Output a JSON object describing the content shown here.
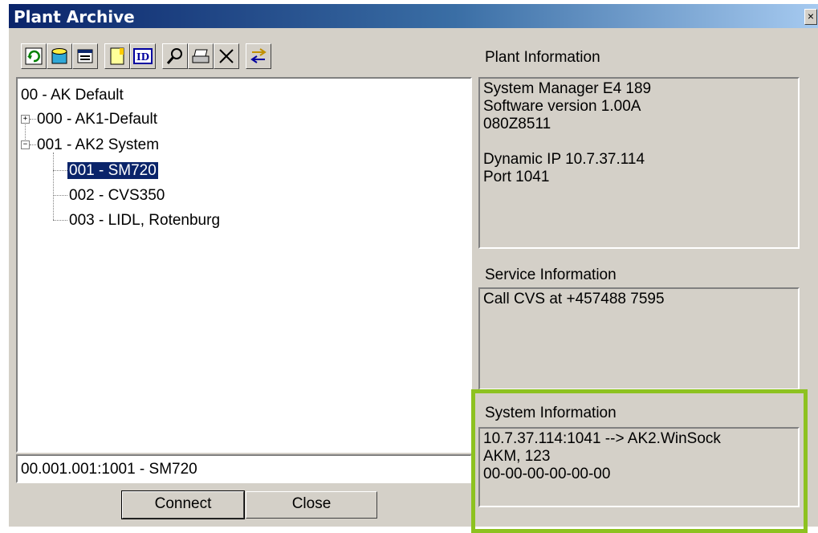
{
  "window": {
    "title": "Plant Archive",
    "close_glyph": "×"
  },
  "toolbar": {
    "icons": [
      "refresh-icon",
      "database-icon",
      "properties-icon",
      "new-document-icon",
      "id-icon",
      "find-icon",
      "print-icon",
      "delete-icon",
      "transfer-icon"
    ]
  },
  "tree": {
    "items": [
      {
        "label": "00 - AK Default",
        "level": 0
      },
      {
        "label": "000 - AK1-Default",
        "level": 1,
        "expander": "+"
      },
      {
        "label": "001 - AK2 System",
        "level": 1,
        "expander": "−"
      },
      {
        "label": "001 - SM720",
        "level": 2,
        "selected": true
      },
      {
        "label": "002 - CVS350",
        "level": 2
      },
      {
        "label": "003 - LIDL, Rotenburg",
        "level": 2
      }
    ]
  },
  "path": {
    "value": "00.001.001:1001 - SM720"
  },
  "buttons": {
    "connect": "Connect",
    "close": "Close"
  },
  "plant_info": {
    "label": "Plant Information",
    "lines": [
      "System Manager E4 189",
      "Software version 1.00A",
      "080Z8511",
      "",
      "Dynamic IP 10.7.37.114",
      "Port 1041"
    ]
  },
  "service_info": {
    "label": "Service Information",
    "lines": [
      "Call CVS at +457488 7595"
    ]
  },
  "system_info": {
    "label": "System Information",
    "lines": [
      "10.7.37.114:1041 --> AK2.WinSock",
      "AKM, 123",
      "00-00-00-00-00-00"
    ]
  },
  "colors": {
    "highlight": "#8dc220",
    "title_bar": "#0a246a",
    "selection": "#0a246a"
  }
}
